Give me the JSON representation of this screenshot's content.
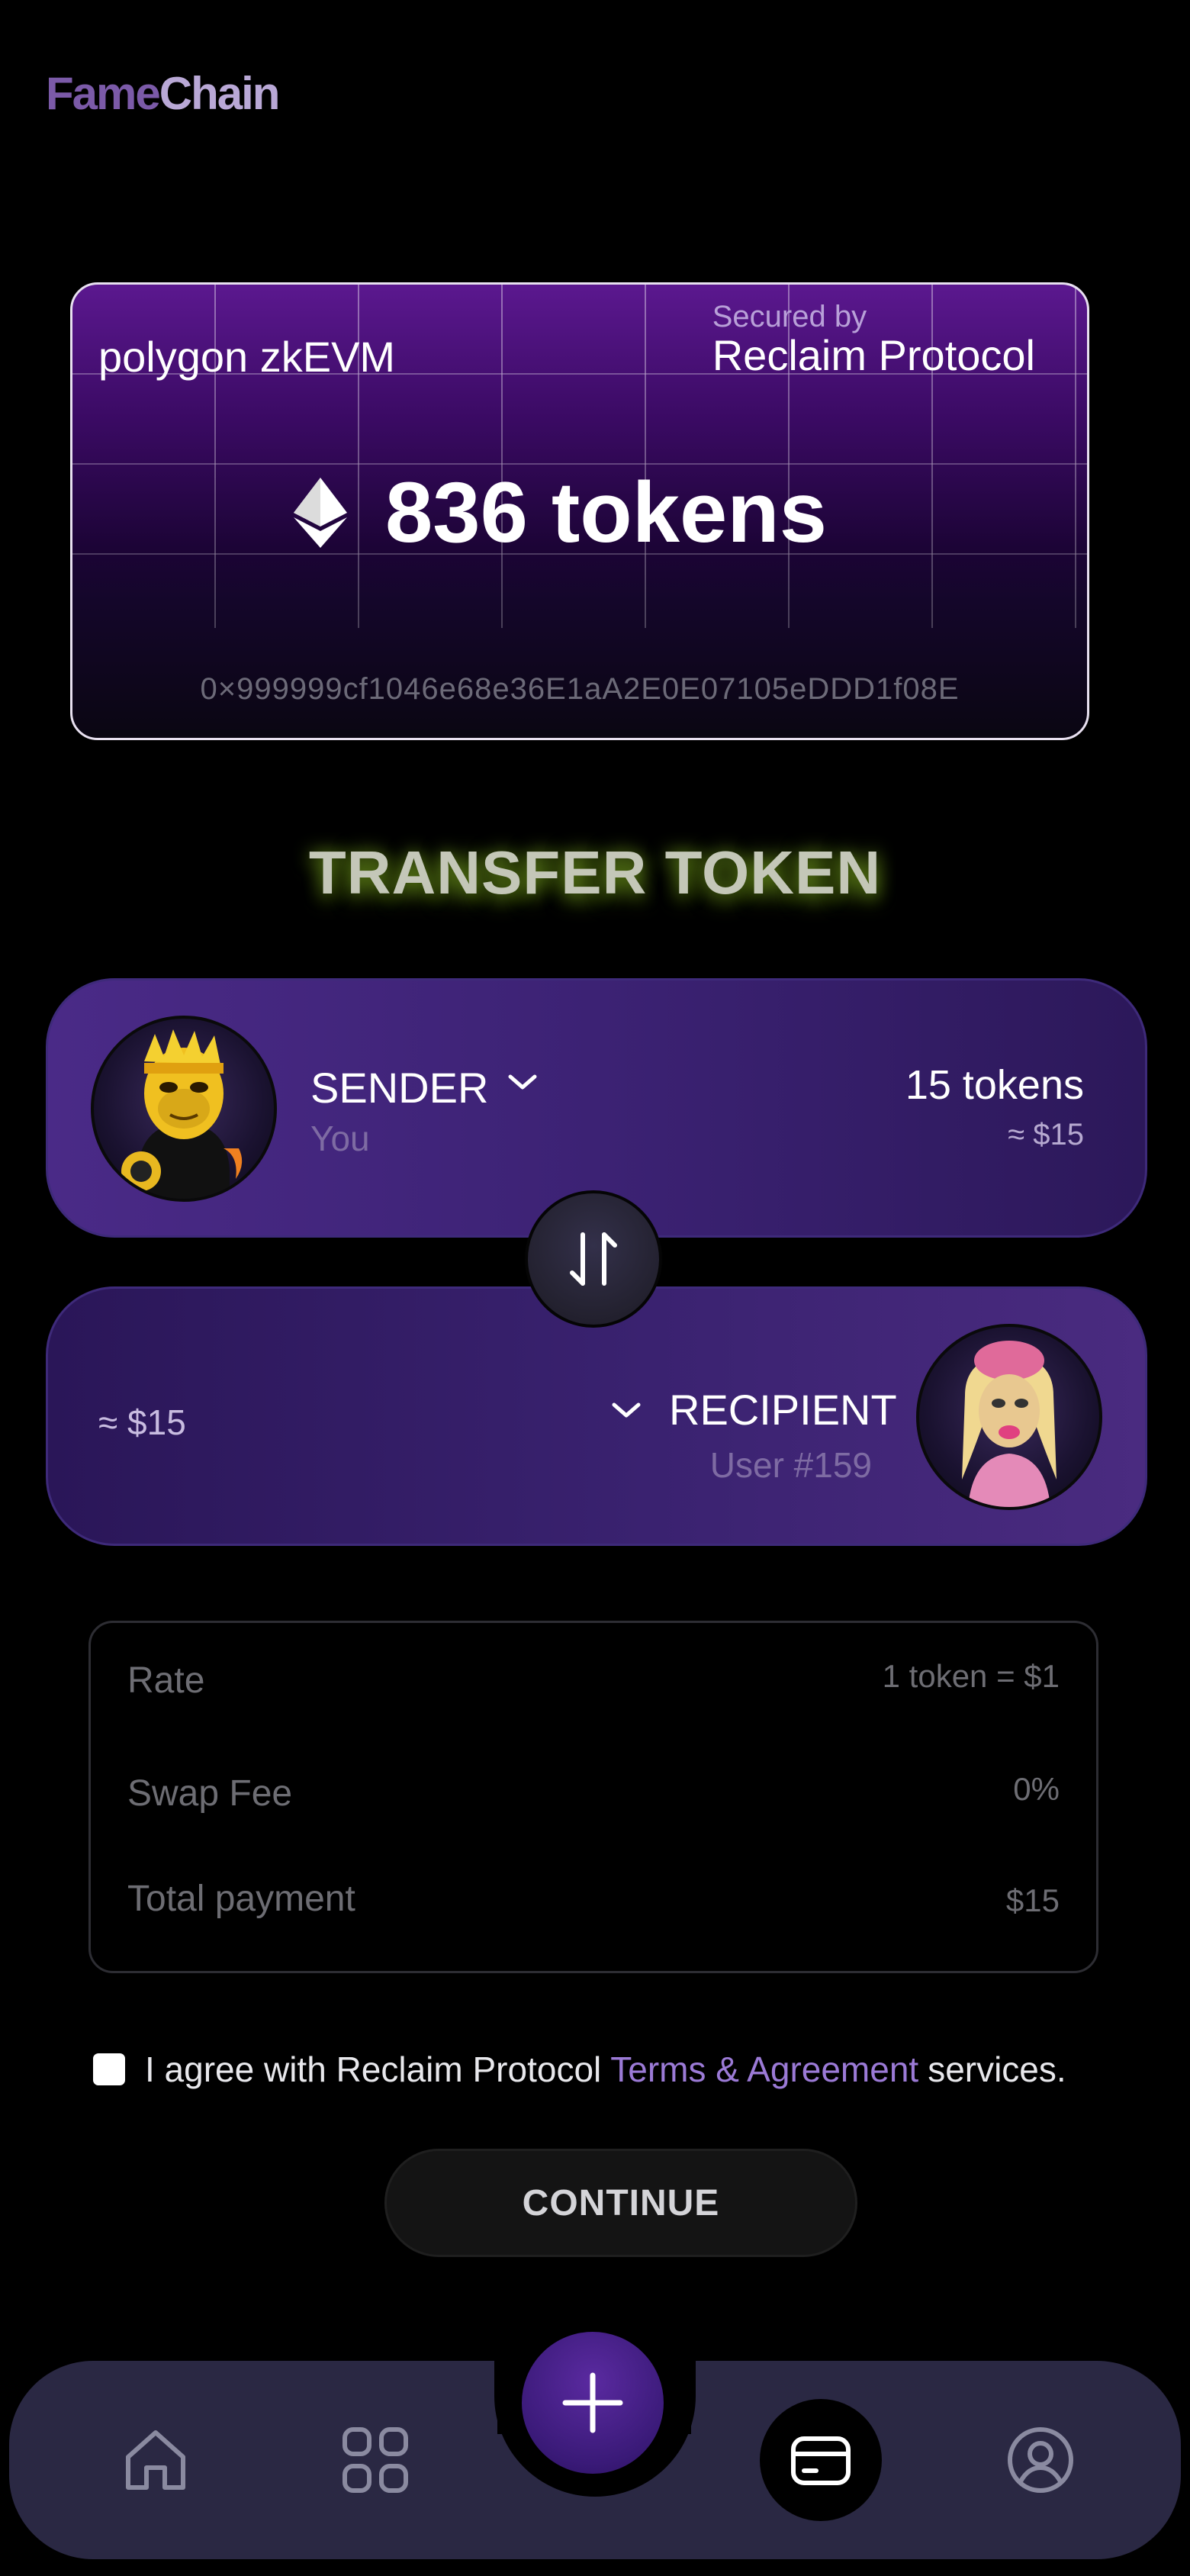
{
  "brand": {
    "part1": "Fame",
    "part2": "Chain"
  },
  "token_card": {
    "network": "polygon zkEVM",
    "secured_by": "Secured by",
    "secured_name": "Reclaim Protocol",
    "amount": "836 tokens",
    "address": "0×999999cf1046e68e36E1aA2E0E07105eDDD1f08E"
  },
  "title": "TRANSFER TOKEN",
  "sender": {
    "label": "SENDER",
    "sub": "You",
    "tokens": "15 tokens",
    "usd": "≈ $15"
  },
  "recipient": {
    "label": "RECIPIENT",
    "sub": "User #159",
    "usd": "≈ $15"
  },
  "summary": {
    "rate_label": "Rate",
    "rate_value": "1 token = $1",
    "fee_label": "Swap Fee",
    "fee_value": "0%",
    "total_label": "Total payment",
    "total_value": "$15"
  },
  "agreement": {
    "prefix": "I agree with Reclaim Protocol",
    "link": "Terms & Agreement",
    "suffix": "services.",
    "checked": false
  },
  "continue_label": "CONTINUE",
  "nav": {
    "items": [
      "home-icon",
      "apps-icon",
      "add-icon",
      "wallet-icon",
      "profile-icon"
    ],
    "active": "wallet-icon"
  },
  "colors": {
    "accent": "#9b7ad6",
    "panel": "#3c2274",
    "card_top": "#5b188f"
  }
}
